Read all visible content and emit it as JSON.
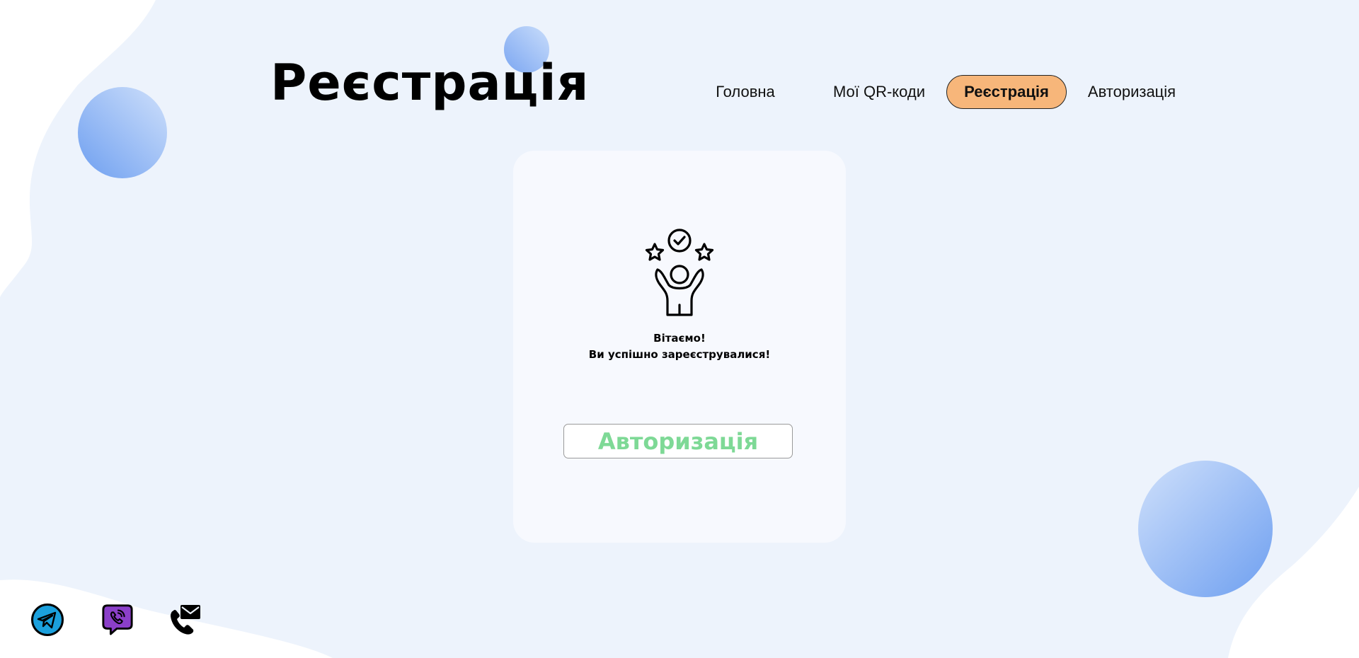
{
  "header": {
    "title": "Реєстрація"
  },
  "nav": {
    "items": [
      {
        "label": "Головна",
        "active": false
      },
      {
        "label": "Мої QR-коди",
        "active": false
      },
      {
        "label": "Реєстрація",
        "active": true
      },
      {
        "label": "Авторизація",
        "active": false
      }
    ],
    "active_color": "#f7b67a"
  },
  "card": {
    "icon": "celebrating-person-icon",
    "greeting": "Вітаємо!",
    "message": "Ви успішно зареєструвалися!",
    "button_label": "Авторизація",
    "button_text_color": "#7ed996"
  },
  "footer": {
    "social": [
      {
        "icon": "telegram-icon"
      },
      {
        "icon": "viber-icon"
      },
      {
        "icon": "phone-mail-icon"
      }
    ]
  },
  "colors": {
    "background": "#edf3fc",
    "accent_blue": "#6e9ff0"
  }
}
